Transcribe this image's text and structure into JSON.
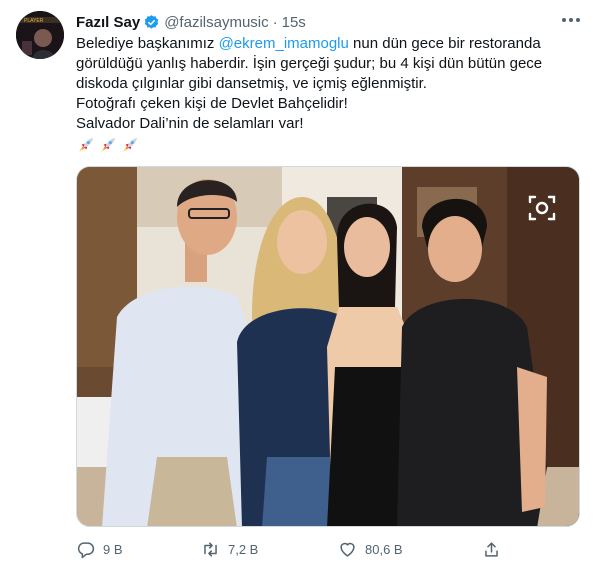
{
  "author": {
    "name": "Fazıl Say",
    "handle": "@fazilsaymusic",
    "separator": "·",
    "time": "15s",
    "verified": true
  },
  "tweet": {
    "line1_before": "Belediye başkanımız ",
    "line1_mention": "@ekrem_imamoglu",
    "line1_after": " nun dün gece bir restoranda",
    "line2": "görüldüğü yanlış haberdir. İşin gerçeği şudur; bu 4 kişi dün bütün gece",
    "line3": "diskoda çılgınlar gibi dansetmiş, ve içmiş eğlenmiştir.",
    "line4": "Fotoğrafı çeken kişi de Devlet Bahçelidir!",
    "line5": "Salvador Dali’nin de selamları var!",
    "emoji": [
      "rocket",
      "rocket",
      "rocket"
    ]
  },
  "colors": {
    "link": "#1d9bf0",
    "muted": "#536471",
    "text": "#0f1419"
  },
  "actions": {
    "reply_count": "9 B",
    "retweet_count": "7,2 B",
    "like_count": "80,6 B"
  }
}
